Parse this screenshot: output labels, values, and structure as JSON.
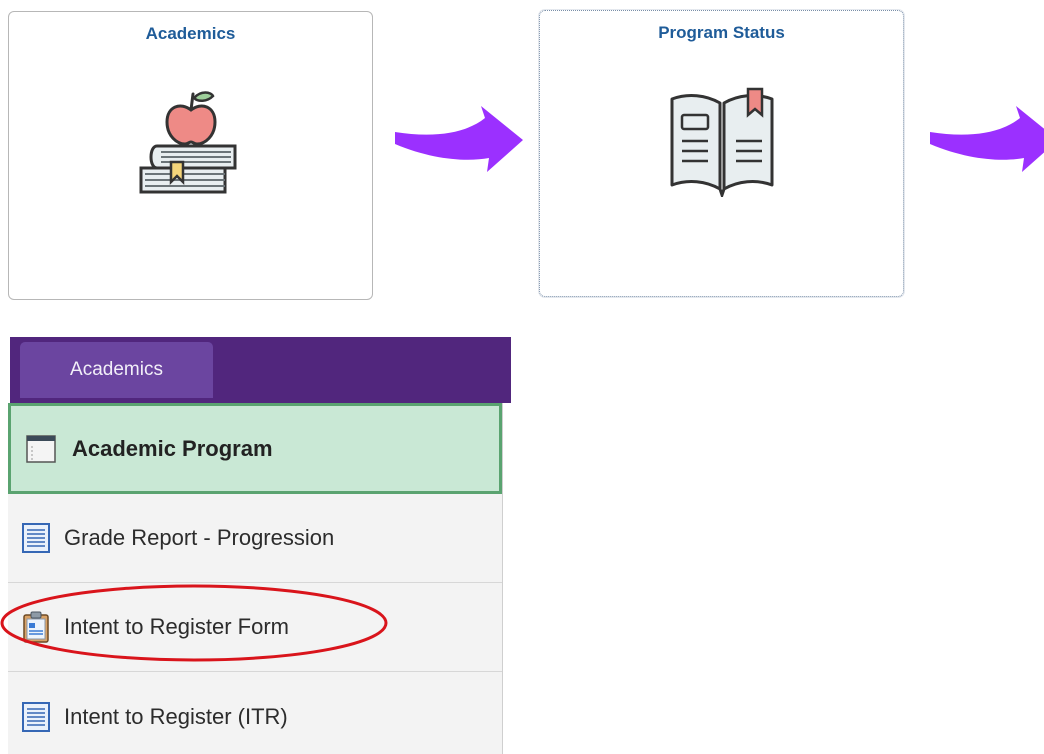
{
  "tiles": [
    {
      "title": "Academics",
      "icon": "books-apple-icon"
    },
    {
      "title": "Program Status",
      "icon": "open-book-icon"
    }
  ],
  "nav": {
    "tab_label": "Academics",
    "items": [
      {
        "label": "Academic Program",
        "icon": "calendar-icon",
        "active": true
      },
      {
        "label": "Grade Report - Progression",
        "icon": "document-list-icon"
      },
      {
        "label": "Intent to Register Form",
        "icon": "clipboard-form-icon",
        "highlighted": true
      },
      {
        "label": "Intent to Register (ITR)",
        "icon": "document-list-icon"
      }
    ]
  },
  "colors": {
    "tile_title": "#1f5c99",
    "arrow": "#9b30ff",
    "nav_header": "#51267d",
    "nav_tab": "#6b45a0",
    "active_item_bg": "#c9e8d5",
    "active_item_border": "#5aa370",
    "annotation": "#d9141b"
  }
}
